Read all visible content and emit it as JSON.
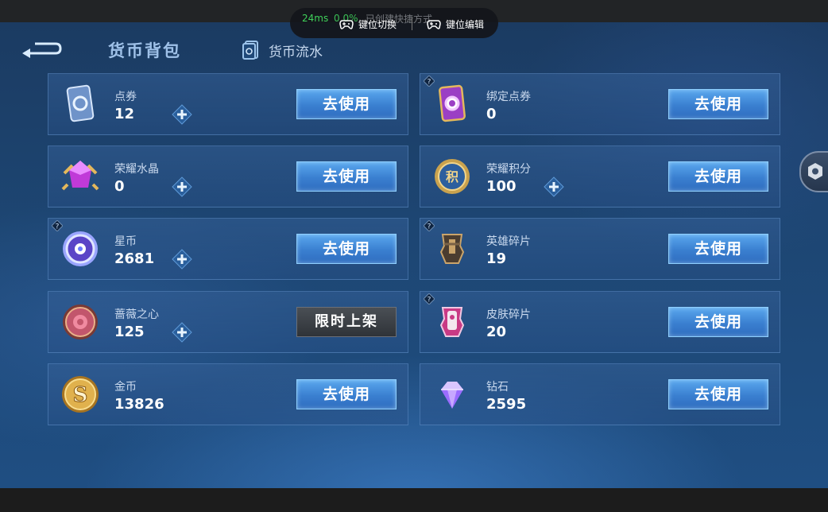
{
  "overlay": {
    "ping": "24ms",
    "loss": "0.0%",
    "hint": "已创建快捷方式",
    "switch_label": "键位切换",
    "edit_label": "键位编辑"
  },
  "header": {
    "title": "货币背包",
    "flow_tab": "货币流水"
  },
  "use_label": "去使用",
  "limited_label": "限时上架",
  "currencies": [
    {
      "name": "点券",
      "value": "12",
      "icon": "voucher-icon",
      "plus": true,
      "help": false
    },
    {
      "name": "绑定点券",
      "value": "0",
      "icon": "bound-voucher-icon",
      "plus": false,
      "help": true
    },
    {
      "name": "荣耀水晶",
      "value": "0",
      "icon": "glory-crystal-icon",
      "plus": true,
      "help": false
    },
    {
      "name": "荣耀积分",
      "value": "100",
      "icon": "glory-points-icon",
      "plus": true,
      "help": false
    },
    {
      "name": "星币",
      "value": "2681",
      "icon": "star-coin-icon",
      "plus": true,
      "help": true
    },
    {
      "name": "英雄碎片",
      "value": "19",
      "icon": "hero-shard-icon",
      "plus": false,
      "help": true
    },
    {
      "name": "蔷薇之心",
      "value": "125",
      "icon": "rose-heart-icon",
      "plus": true,
      "help": false
    },
    {
      "name": "皮肤碎片",
      "value": "20",
      "icon": "skin-shard-icon",
      "plus": false,
      "help": true
    },
    {
      "name": "金币",
      "value": "13826",
      "icon": "gold-coin-icon",
      "plus": false,
      "help": false
    },
    {
      "name": "钻石",
      "value": "2595",
      "icon": "diamond-icon",
      "plus": false,
      "help": false
    }
  ],
  "colors": {
    "button_blue": "#3a7fd0",
    "card_bg": "#345f96",
    "background": "#1d4673"
  }
}
